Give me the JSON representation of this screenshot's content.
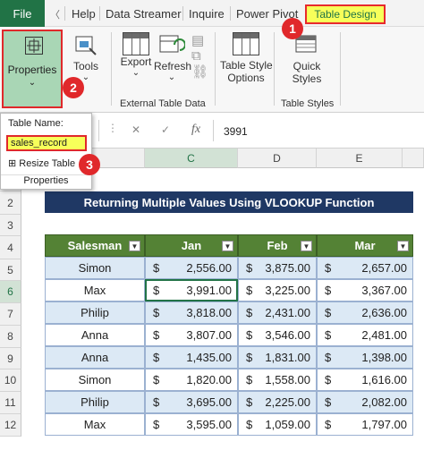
{
  "menubar": {
    "file": "File",
    "items": [
      "Help",
      "Data Streamer",
      "Inquire",
      "Power Pivot"
    ],
    "active_tab": "Table Design"
  },
  "ribbon": {
    "properties": "Properties",
    "tools": "Tools",
    "export": "Export",
    "refresh": "Refresh",
    "table_style_options_1": "Table Style",
    "table_style_options_2": "Options",
    "quick_styles_1": "Quick",
    "quick_styles_2": "Styles",
    "group_external": "External Table Data",
    "group_styles": "Table Styles"
  },
  "properties_panel": {
    "label": "Table Name:",
    "value": "sales_record",
    "resize": "Resize Table",
    "footer": "Properties"
  },
  "formula_bar": {
    "cancel": "✕",
    "enter": "✓",
    "fx": "fx",
    "value": "3991"
  },
  "badges": [
    "1",
    "2",
    "3"
  ],
  "columns": [
    "C",
    "D",
    "E"
  ],
  "rows": [
    "2",
    "3",
    "4",
    "5",
    "6",
    "7",
    "8",
    "9",
    "10",
    "11",
    "12"
  ],
  "sheet_title": "Returning Multiple Values Using VLOOKUP Function",
  "table": {
    "headers": [
      "Salesman",
      "Jan",
      "Feb",
      "Mar"
    ],
    "dropdown_glyph": "▼",
    "currency": "$",
    "rows": [
      [
        "Simon",
        "2,556.00",
        "3,875.00",
        "2,657.00"
      ],
      [
        "Max",
        "3,991.00",
        "3,225.00",
        "3,367.00"
      ],
      [
        "Philip",
        "3,818.00",
        "2,431.00",
        "2,636.00"
      ],
      [
        "Anna",
        "3,807.00",
        "3,546.00",
        "2,481.00"
      ],
      [
        "Anna",
        "1,435.00",
        "1,831.00",
        "1,398.00"
      ],
      [
        "Simon",
        "1,820.00",
        "1,558.00",
        "1,616.00"
      ],
      [
        "Philip",
        "3,695.00",
        "2,225.00",
        "2,082.00"
      ],
      [
        "Max",
        "3,595.00",
        "1,059.00",
        "1,797.00"
      ]
    ]
  },
  "colors": {
    "excel_green": "#217346",
    "header_green": "#548235",
    "title_navy": "#1f3864",
    "band_blue": "#dce9f5",
    "highlight_yellow": "#f7ff5a",
    "badge_red": "#e0282b"
  }
}
